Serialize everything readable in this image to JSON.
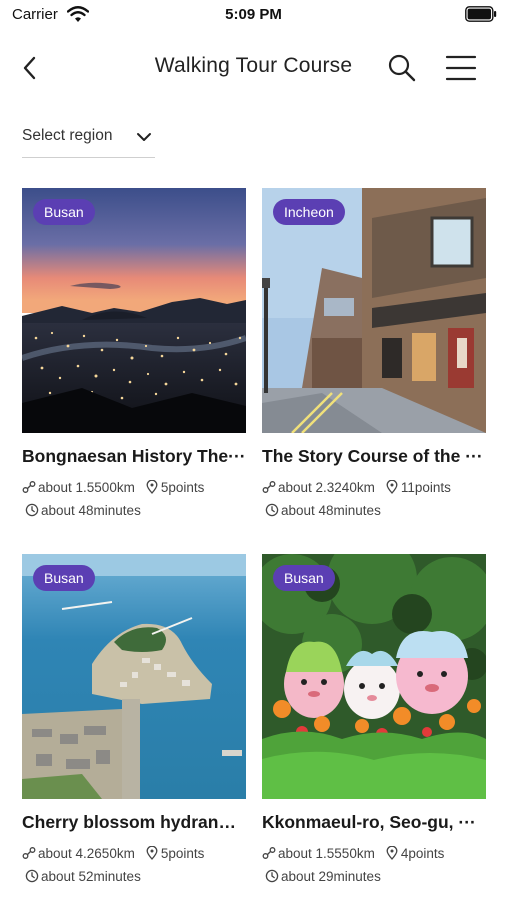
{
  "status_bar": {
    "carrier": "Carrier",
    "time": "5:09 PM"
  },
  "nav": {
    "title": "Walking Tour Course",
    "back_icon": "chevron-left-icon",
    "search_icon": "search-icon",
    "menu_icon": "hamburger-menu-icon"
  },
  "region_select": {
    "label": "Select region",
    "icon": "chevron-down-icon"
  },
  "courses": [
    {
      "region": "Busan",
      "title": "Bongnaesan History The···",
      "distance": "about 1.5500km",
      "points": "5points",
      "duration": "about 48minutes"
    },
    {
      "region": "Incheon",
      "title": "The Story Course of the ···",
      "distance": "about 2.3240km",
      "points": "11points",
      "duration": "about 48minutes"
    },
    {
      "region": "Busan",
      "title": "Cherry blossom hydrang···",
      "distance": "about 4.2650km",
      "points": "5points",
      "duration": "about 52minutes"
    },
    {
      "region": "Busan",
      "title": "Kkonmaeul-ro, Seo-gu, ···",
      "distance": "about 1.5550km",
      "points": "4points",
      "duration": "about 29minutes"
    }
  ],
  "colors": {
    "badge": "#5b3fb3",
    "text": "#1a1a1a",
    "meta": "#444444"
  }
}
